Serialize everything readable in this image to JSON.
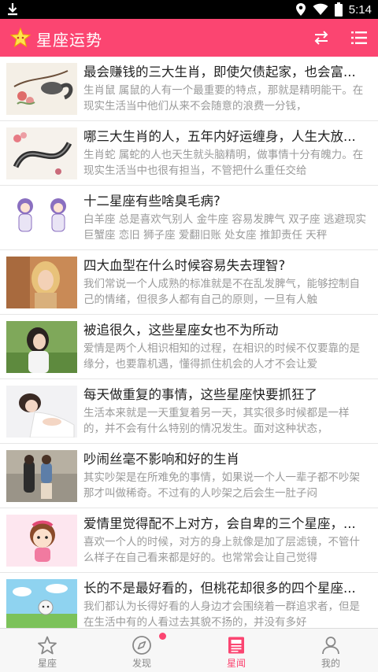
{
  "status_bar": {
    "time": "5:14",
    "icons": [
      "download-icon",
      "location-icon",
      "wifi-icon",
      "battery-icon"
    ]
  },
  "app_bar": {
    "title": "星座运势",
    "color": "#fb4571",
    "icons": [
      "star-logo-icon",
      "swap-icon",
      "list-menu-icon"
    ]
  },
  "feed": [
    {
      "title": "最会赚钱的三大生肖，即使欠债起家，也会富...",
      "summary": "生肖鼠 属鼠的人有一个最重要的特点，那就是精明能干。在现实生活当中他们从来不会随意的浪费一分钱，",
      "thumb": "ink-squirrel-painting"
    },
    {
      "title": "哪三大生肖的人，五年内好运缠身，人生大放...",
      "summary": "生肖蛇 属蛇的人也天生就头脑精明，做事情十分有魄力。在现实生活当中也很有担当，不管把什么重任交给",
      "thumb": "ink-snake-painting"
    },
    {
      "title": "十二星座有些啥臭毛病?",
      "summary": "白羊座 总是喜欢气别人 金牛座 容易发脾气 双子座 逃避现实 巨蟹座 恋旧 狮子座 爱翻旧账 处女座 推卸责任 天秤",
      "thumb": "twin-cartoon-girls"
    },
    {
      "title": "四大血型在什么时候容易失去理智?",
      "summary": "我们常说一个人成熟的标准就是不在乱发脾气，能够控制自己的情绪，但很多人都有自己的原则，一旦有人触",
      "thumb": "blonde-girl-portrait"
    },
    {
      "title": "被追很久，这些星座女也不为所动",
      "summary": "爱情是两个人相识相知的过程，在相识的时候不仅要靠的是缘分，也要靠机遇，懂得抓住机会的人才不会让爱",
      "thumb": "girl-in-park"
    },
    {
      "title": "每天做重复的事情，这些星座快要抓狂了",
      "summary": "生活本来就是一天重复着另一天，其实很多时候都是一样的，并不会有什么特别的情况发生。面对这种状态，",
      "thumb": "girl-lying-on-bed"
    },
    {
      "title": "吵闹丝毫不影响和好的生肖",
      "summary": "其实吵架是在所难免的事情，如果说一个人一辈子都不吵架那才叫做稀奇。不过有的人吵架之后会生一肚子闷",
      "thumb": "couple-on-street"
    },
    {
      "title": "爱情里觉得配不上对方，会自卑的三个星座，...",
      "summary": "喜欢一个人的时候，对方的身上就像是加了层滤镜，不管什么样子在自己看来都是好的。也常常会让自己觉得",
      "thumb": "pink-cartoon-girl"
    },
    {
      "title": "长的不是最好看的，但桃花却很多的四个星座...",
      "summary": "我们都认为长得好看的人身边才会围绕着一群追求者，但是在生活中有的人看过去其貌不扬的，并没有多好",
      "thumb": "cartoon-sky-scene"
    }
  ],
  "bottom_nav": [
    {
      "label": "星座",
      "icon": "star-outline-icon",
      "active": false
    },
    {
      "label": "发现",
      "icon": "compass-icon",
      "active": false,
      "badge": true
    },
    {
      "label": "星闻",
      "icon": "news-icon",
      "active": true
    },
    {
      "label": "我的",
      "icon": "user-icon",
      "active": false
    }
  ]
}
